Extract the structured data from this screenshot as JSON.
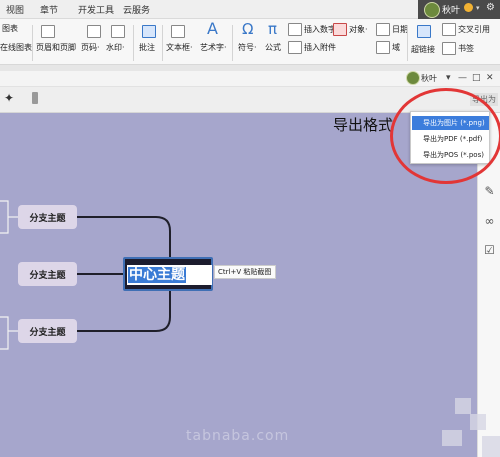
{
  "menubar": {
    "tabs": [
      "视图",
      "章节",
      "开发工具",
      "云服务"
    ],
    "user_name": "秋叶",
    "top_right_glyph": "⚙"
  },
  "ribbon": {
    "left_items": [
      "图表",
      "在线图表"
    ],
    "header_footer": "页眉和页脚",
    "page_number": "页码·",
    "watermark": "水印·",
    "comment": "批注",
    "textbox": "文本框·",
    "wordart": "艺术字·",
    "symbol": "符号·",
    "formula": "公式",
    "insert_number": "插入数字",
    "object": "对象·",
    "date": "日期",
    "insert_attachment": "插入附件",
    "field": "域",
    "hyperlink": "超链接",
    "cross_ref": "交叉引用",
    "bookmark": "书签"
  },
  "mindmap": {
    "user_name": "秋叶",
    "export_button": "导出为",
    "annotation": "导出格式",
    "center_label": "中心主题",
    "paste_hint": "Ctrl+V 粘贴截图",
    "branches": [
      "分支主题",
      "分支主题",
      "分支主题"
    ],
    "export_menu": [
      {
        "label": "导出为图片 (*.png)",
        "active": true
      },
      {
        "label": "导出为PDF (*.pdf)",
        "active": false
      },
      {
        "label": "导出为POS (*.pos)",
        "active": false
      }
    ],
    "watermark_text": "tabnaba.com",
    "rail_icons": [
      "edit-note-icon",
      "link-icon",
      "clipboard-check-icon"
    ]
  },
  "colors": {
    "canvas": "#a6a6cc",
    "branch_fill": "#ddd6e8",
    "center_fill": "#1c1c2e",
    "highlight": "#3c7ddc",
    "annotation_circle": "#e23636"
  }
}
